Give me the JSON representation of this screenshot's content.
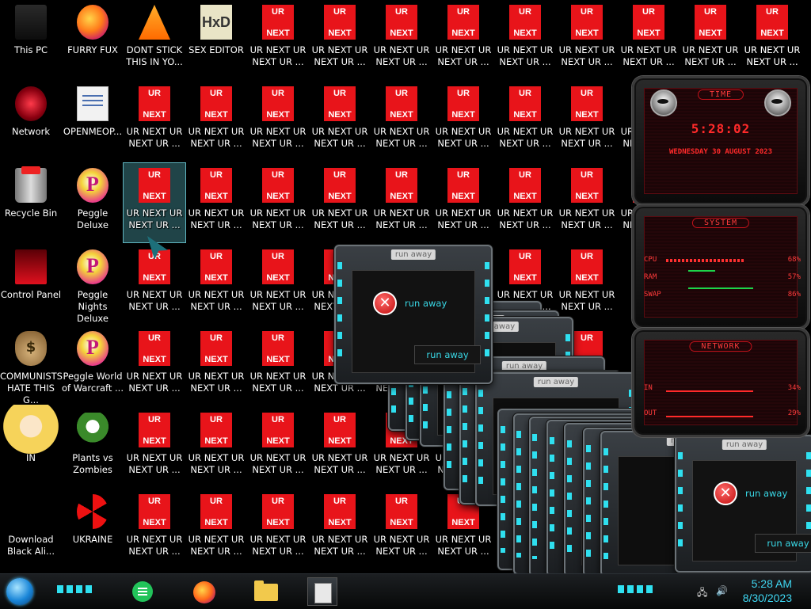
{
  "desktop": {
    "column_left": [
      {
        "label": "This PC",
        "icon": "this-pc-icon",
        "style": "s-thispc"
      },
      {
        "label": "Network",
        "icon": "network-icon",
        "style": "s-network"
      },
      {
        "label": "Recycle Bin",
        "icon": "recycle-bin-icon",
        "style": "s-bin"
      },
      {
        "label": "Control Panel",
        "icon": "control-panel-icon",
        "style": "s-control"
      },
      {
        "label": "COMMUNISTS HATE THIS G...",
        "icon": "money-bag-icon",
        "style": "s-money"
      },
      {
        "label": "IN",
        "icon": "star-butterfly-icon",
        "style": "s-star"
      },
      {
        "label": "Download Black Ali...",
        "icon": "download-icon",
        "style": ""
      }
    ],
    "column_second": [
      {
        "label": "FURRY FUX",
        "icon": "firefox-icon",
        "style": "s-fox"
      },
      {
        "label": "OPENMEOP...",
        "icon": "document-icon",
        "style": "s-doc"
      },
      {
        "label": "Peggle Deluxe",
        "icon": "peggle-icon",
        "style": "s-peggle"
      },
      {
        "label": "Peggle Nights Deluxe",
        "icon": "peggle-icon",
        "style": "s-peggle"
      },
      {
        "label": "Peggle World of Warcraft ...",
        "icon": "peggle-icon",
        "style": "s-peggle"
      },
      {
        "label": "Plants vs Zombies",
        "icon": "plants-vs-zombies-icon",
        "style": "s-plants"
      },
      {
        "label": "UKRAINE",
        "icon": "radiation-icon",
        "style": "s-ukraine"
      }
    ],
    "top_row_extra": [
      {
        "label": "DONT STICK THIS IN YO...",
        "icon": "vlc-cone-icon",
        "style": "s-vlc"
      },
      {
        "label": "SEX EDITOR",
        "icon": "hxd-icon",
        "style": "s-hxd",
        "glyph": "HxD"
      }
    ],
    "ur_icon": {
      "top": "UR",
      "bottom": "NEXT",
      "label": "UR NEXT UR NEXT UR ...",
      "color": "#e8141a"
    }
  },
  "dialogs": {
    "title": "run away",
    "message": "run away",
    "button": "run away"
  },
  "widget": {
    "time_header": "TIME",
    "clock": "5:28:02",
    "date": "WEDNESDAY 30 AUGUST 2023",
    "system_header": "SYSTEM",
    "cpu_label": "CPU",
    "cpu_value": "68%",
    "ram_label": "RAM",
    "ram_value": "57%",
    "swap_label": "SWAP",
    "swap_value": "86%",
    "network_header": "NETWORK",
    "in_label": "IN",
    "in_value": "34%",
    "out_label": "OUT",
    "out_value": "29%",
    "accent": "#ff2a2a"
  },
  "taskbar": {
    "apps": [
      {
        "name": "chat-app-icon"
      },
      {
        "name": "firefox-icon"
      },
      {
        "name": "file-explorer-icon"
      },
      {
        "name": "notepad-icon"
      }
    ],
    "tray_network": "🖧",
    "tray_volume": "🔊",
    "time": "5:28 AM",
    "date": "8/30/2023",
    "time_color": "#3fd7f2"
  }
}
